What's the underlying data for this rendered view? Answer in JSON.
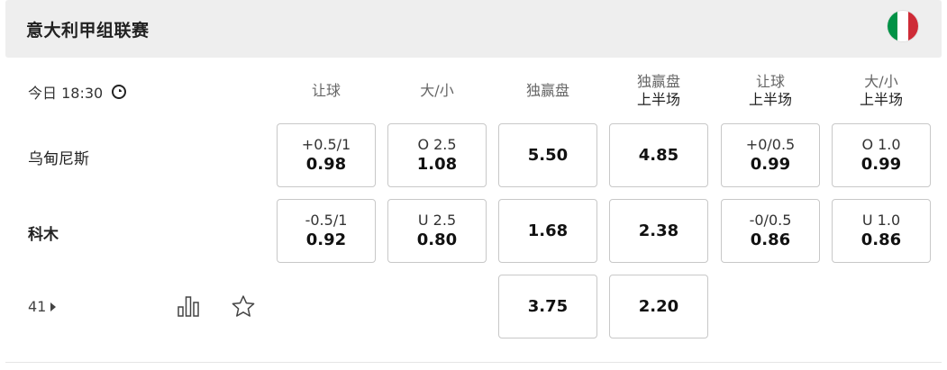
{
  "league": {
    "title": "意大利甲组联赛",
    "flag_colors": [
      "#009246",
      "#ffffff",
      "#ce2b37"
    ]
  },
  "match": {
    "time": "今日 18:30"
  },
  "columns": [
    {
      "l1": "让球",
      "l2": ""
    },
    {
      "l1": "大/小",
      "l2": ""
    },
    {
      "l1": "独赢盘",
      "l2": ""
    },
    {
      "l1": "独赢盘",
      "l2": "上半场"
    },
    {
      "l1": "让球",
      "l2": "上半场"
    },
    {
      "l1": "大/小",
      "l2": "上半场"
    }
  ],
  "teams": {
    "home": "乌甸尼斯",
    "away": "科木"
  },
  "odds": {
    "home": [
      {
        "line": "+0.5/1",
        "price": "0.98"
      },
      {
        "line": "O 2.5",
        "price": "1.08"
      },
      {
        "line": "",
        "price": "5.50"
      },
      {
        "line": "",
        "price": "4.85"
      },
      {
        "line": "+0/0.5",
        "price": "0.99"
      },
      {
        "line": "O 1.0",
        "price": "0.99"
      }
    ],
    "away": [
      {
        "line": "-0.5/1",
        "price": "0.92"
      },
      {
        "line": "U 2.5",
        "price": "0.80"
      },
      {
        "line": "",
        "price": "1.68"
      },
      {
        "line": "",
        "price": "2.38"
      },
      {
        "line": "-0/0.5",
        "price": "0.86"
      },
      {
        "line": "U 1.0",
        "price": "0.86"
      }
    ],
    "draw": [
      {
        "price": "3.75"
      },
      {
        "price": "2.20"
      }
    ]
  },
  "footer": {
    "more_count": "41"
  },
  "icons": {
    "clock": "clock-icon",
    "stats": "stats-icon",
    "star": "star-icon",
    "more": "triangle-right-icon"
  }
}
